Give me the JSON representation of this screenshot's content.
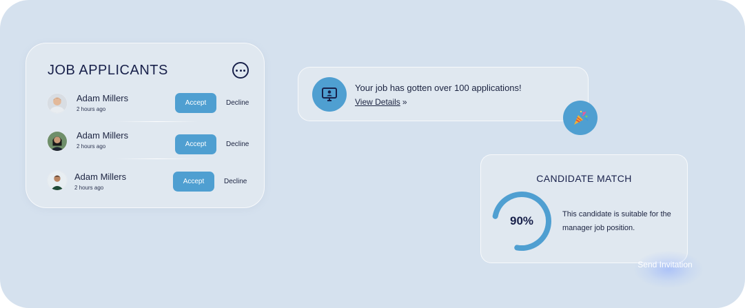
{
  "applicants_card": {
    "title": "JOB APPLICANTS",
    "items": [
      {
        "name": "Adam Millers",
        "time": "2 hours ago",
        "accept_label": "Accept",
        "decline_label": "Decline"
      },
      {
        "name": "Adam Millers",
        "time": "2 hours ago",
        "accept_label": "Accept",
        "decline_label": "Decline"
      },
      {
        "name": "Adam Millers",
        "time": "2 hours ago",
        "accept_label": "Accept",
        "decline_label": "Decline"
      }
    ]
  },
  "notification": {
    "message": "Your job has gotten over 100 applications!",
    "link_label": "View Details",
    "icon": "monitor-user-icon",
    "badge_icon": "party-popper-icon"
  },
  "candidate_match": {
    "title": "CANDIDATE MATCH",
    "percent_label": "90%",
    "percent_value": 0.9,
    "description": "This candidate is suitable for the manager job position."
  },
  "send_invitation": {
    "label": "Send Invitation"
  },
  "colors": {
    "background": "#d5e1ee",
    "accent": "#4f9fd1",
    "text_dark": "#18204a"
  }
}
